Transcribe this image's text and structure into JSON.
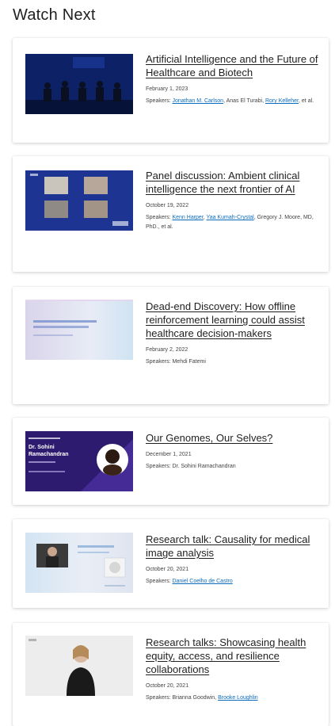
{
  "header": {
    "title": "Watch Next"
  },
  "cards": [
    {
      "title": "Artificial Intelligence and the Future of Healthcare and Biotech",
      "date": "February 1, 2023",
      "speakers_prefix": "Speakers: ",
      "speakers": [
        {
          "name": "Jonathan M. Carlson",
          "link": true
        },
        {
          "name": ", Anas El Turabi, ",
          "link": false
        },
        {
          "name": "Rory Kelleher",
          "link": true
        },
        {
          "name": ", et al.",
          "link": false
        }
      ],
      "thumb_icon": "panel-stage-icon"
    },
    {
      "title": "Panel discussion: Ambient clinical intelligence the next frontier of AI",
      "date": "October 19, 2022",
      "speakers_prefix": "Speakers: ",
      "speakers": [
        {
          "name": "Kenn Harper",
          "link": true
        },
        {
          "name": ", ",
          "link": false
        },
        {
          "name": "Yaa Kumah-Crystal",
          "link": true
        },
        {
          "name": ", Gregory J. Moore, MD, PhD., et al.",
          "link": false
        }
      ],
      "thumb_icon": "video-grid-icon"
    },
    {
      "title": "Dead-end Discovery: How offline reinforcement learning could assist healthcare decision-makers",
      "date": "February 2, 2022",
      "speakers_prefix": "Speakers: ",
      "speakers": [
        {
          "name": "Mehdi Fatemi",
          "link": false
        }
      ],
      "thumb_icon": "slide-title-icon"
    },
    {
      "title": "Our Genomes, Our Selves?",
      "date": "December 1, 2021",
      "speakers_prefix": "Speakers: ",
      "speakers": [
        {
          "name": "Dr. Sohini Ramachandran",
          "link": false
        }
      ],
      "thumb_icon": "speaker-portrait-icon"
    },
    {
      "title": "Research talk: Causality for medical image analysis",
      "date": "October 20, 2021",
      "speakers_prefix": "Speakers: ",
      "speakers": [
        {
          "name": "Daniel Coelho de Castro",
          "link": true
        }
      ],
      "thumb_icon": "presentation-icon"
    },
    {
      "title": "Research talks: Showcasing health equity, access, and resilience collaborations",
      "date": "October 20, 2021",
      "speakers_prefix": "Speakers: ",
      "speakers": [
        {
          "name": "Brianna Goodwin, ",
          "link": false
        },
        {
          "name": "Brooke Loughlin",
          "link": true
        }
      ],
      "thumb_icon": "presenter-icon"
    }
  ],
  "thumb4": {
    "line1": "Dr. Sohini",
    "line2": "Ramachandran"
  }
}
